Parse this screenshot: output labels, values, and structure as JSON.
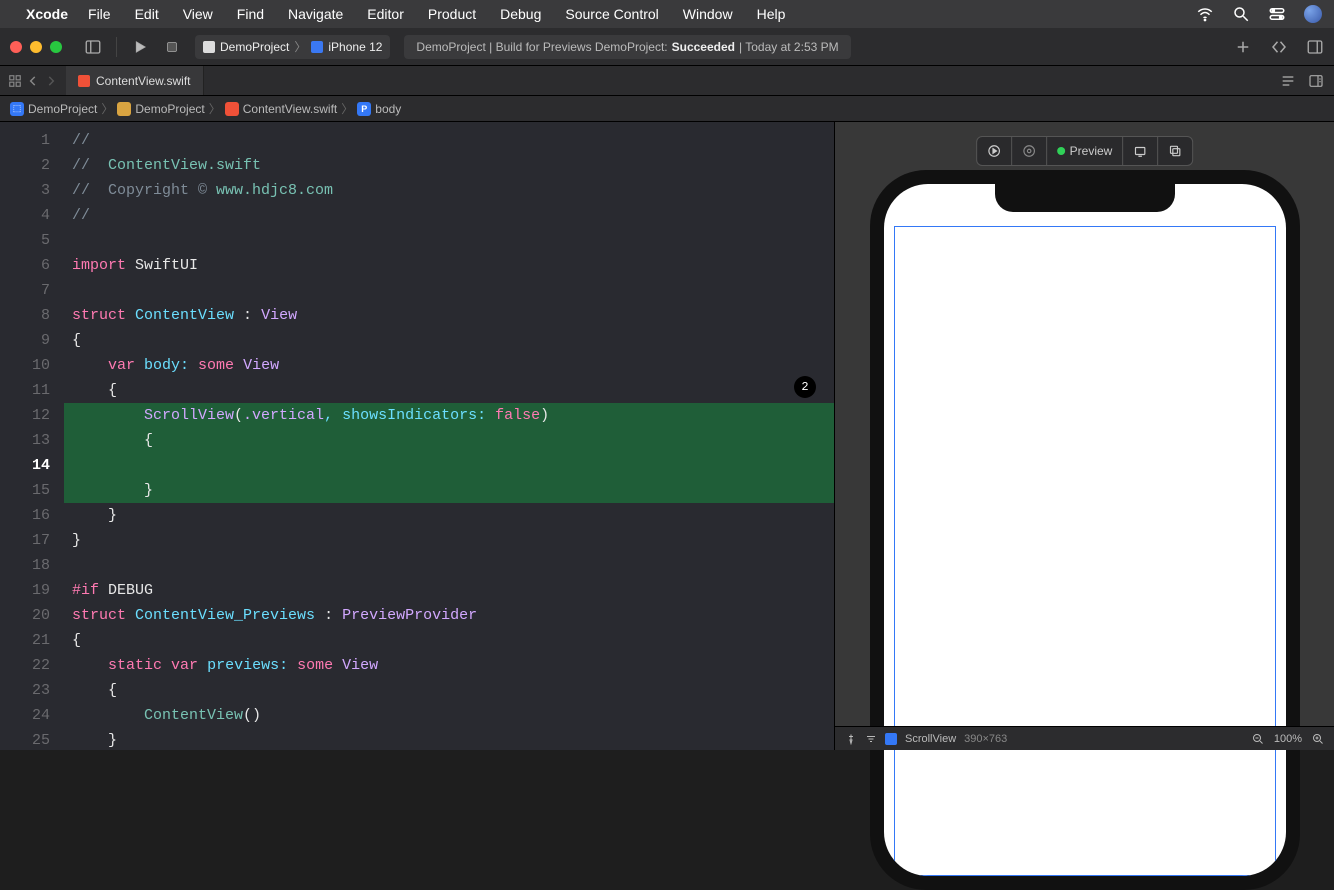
{
  "menubar": {
    "app": "Xcode",
    "items": [
      "File",
      "Edit",
      "View",
      "Find",
      "Navigate",
      "Editor",
      "Product",
      "Debug",
      "Source Control",
      "Window",
      "Help"
    ]
  },
  "toolbar": {
    "scheme_project": "DemoProject",
    "scheme_device": "iPhone 12",
    "status_prefix": "DemoProject | Build for Previews DemoProject: ",
    "status_result": "Succeeded",
    "status_time": " | Today at 2:53 PM"
  },
  "tabs": {
    "active": "ContentView.swift"
  },
  "breadcrumb": {
    "segments": [
      "DemoProject",
      "DemoProject",
      "ContentView.swift",
      "body"
    ]
  },
  "code": {
    "lines_count": 25,
    "issue_count": "2",
    "l1": "//",
    "l2a": "//  ",
    "l2b": "ContentView.swift",
    "l3a": "//  Copyright © ",
    "l3b": "www.hdjc8.com",
    "l4": "//",
    "l5": "",
    "l6a": "import",
    "l6b": " SwiftUI",
    "l7": "",
    "l8a": "struct",
    "l8b": " ContentView ",
    "l8c": ": ",
    "l8d": "View",
    "l9": "{",
    "l10a": "    ",
    "l10b": "var",
    "l10c": " body: ",
    "l10d": "some",
    "l10e": " View",
    "l11": "    {",
    "l12a": "        ",
    "l12b": "ScrollView",
    "l12c": "(",
    "l12d": ".vertical",
    "l12e": ", showsIndicators: ",
    "l12f": "false",
    "l12g": ")",
    "l13": "        {",
    "l14": "",
    "l15": "        }",
    "l16": "    }",
    "l17": "}",
    "l18": "",
    "l19a": "#if",
    "l19b": " DEBUG",
    "l20a": "struct",
    "l20b": " ContentView_Previews ",
    "l20c": ": ",
    "l20d": "PreviewProvider",
    "l21": "{",
    "l22a": "    ",
    "l22b": "static",
    "l22c": " ",
    "l22d": "var",
    "l22e": " previews: ",
    "l22f": "some",
    "l22g": " View",
    "l23": "    {",
    "l24a": "        ",
    "l24b": "ContentView",
    "l24c": "()",
    "l25": "    }"
  },
  "preview": {
    "label": "Preview",
    "status_name": "ScrollView",
    "status_dims": "390×763",
    "zoom": "100%"
  }
}
